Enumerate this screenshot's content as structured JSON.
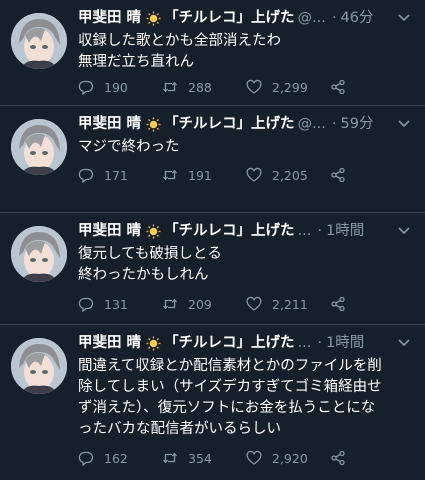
{
  "author": {
    "name": "甲斐田 晴",
    "emoji": "sun-emoji",
    "name_suffix": "「チルレコ」上げた",
    "handle_truncated": "@...",
    "ellipsis": "..."
  },
  "tweets": [
    {
      "time": "46分",
      "lines": [
        "収録した歌とかも全部消えたわ",
        "無理だ立ち直れん"
      ],
      "replies": "190",
      "retweets": "288",
      "likes": "2,299"
    },
    {
      "time": "59分",
      "lines": [
        "マジで終わった"
      ],
      "replies": "171",
      "retweets": "191",
      "likes": "2,205"
    },
    {
      "time": "1時間",
      "lines": [
        "復元しても破損しとる",
        "終わったかもしれん"
      ],
      "replies": "131",
      "retweets": "209",
      "likes": "2,211"
    },
    {
      "time": "1時間",
      "lines": [
        "間違えて収録とか配信素材とかのファイルを削",
        "除してしまい（サイズデカすぎてゴミ箱経由せ",
        "ず消えた）、復元ソフトにお金を払うことにな",
        "ったバカな配信者がいるらしい"
      ],
      "replies": "162",
      "retweets": "354",
      "likes": "2,920"
    }
  ],
  "icons": {
    "reply": "reply-icon",
    "retweet": "retweet-icon",
    "like": "like-icon",
    "share": "share-icon",
    "more": "chevron-down-icon"
  },
  "colors": {
    "background": "#15202b",
    "secondary_text": "#8899a6",
    "divider": "#38444d"
  }
}
